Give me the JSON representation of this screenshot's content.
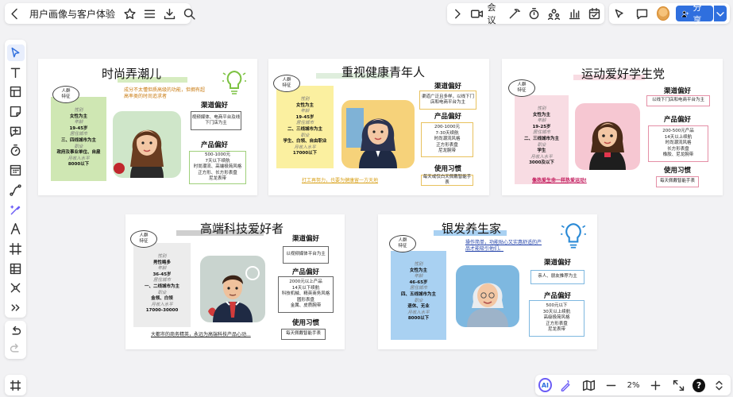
{
  "header": {
    "doc_title": "用户画像与客户体验",
    "meeting_label": "会议",
    "share_label": "分享"
  },
  "bottom": {
    "zoom": "2%",
    "ai_label": "AI"
  },
  "colors": {
    "accent": "#2f6fde",
    "green": "#cfe7b3",
    "yellow": "#fbf0a0",
    "pink": "#f8dce3",
    "gray": "#ececec",
    "blue": "#a9d1f2"
  },
  "cards": [
    {
      "title": "时尚弄潮儿",
      "tag": "人群\n特征",
      "attrs": [
        [
          "性别",
          "女性为主"
        ],
        [
          "年龄",
          "19-45岁"
        ],
        [
          "居住城市",
          "三、四线城市为主"
        ],
        [
          "职业",
          "政府及事业单位、自雇"
        ],
        [
          "月收入水平",
          "8000以下"
        ]
      ],
      "slogan": "成分不太懂但质高级的功能，但拥有超高率类的时尚追求者",
      "channel_title": "渠道偏好",
      "channel": "视频媒体、电商平台及线下门店为主",
      "product_title": "产品偏好",
      "product": "500-1000元\n7天以下续航\n时尚潮流、高端极简风格\n正方形、长方形表盘\n尼龙表带"
    },
    {
      "title": "重视健康青年人",
      "tag": "人群\n特征",
      "attrs": [
        [
          "性别",
          "女性为主"
        ],
        [
          "年龄",
          "19-45岁"
        ],
        [
          "居住城市",
          "二、三线城市为主"
        ],
        [
          "职业",
          "学生、白领、自由职业"
        ],
        [
          "月收入水平",
          "17000以下"
        ]
      ],
      "slogan": "打工再努力，也要为健康留一方天地",
      "channel_title": "渠道偏好",
      "channel": "渠道广泛且多样，以线下门店和电商平台为主",
      "product_title": "产品偏好",
      "product": "200-1000元\n7-30天续航\n时尚潮流风格\n正方形表盘\n尼龙腕带",
      "habit_title": "使用习惯",
      "habit": "每天或仅白天佩戴智能手表"
    },
    {
      "title": "运动爱好学生党",
      "tag": "人群\n特征",
      "attrs": [
        [
          "性别",
          "女性为主"
        ],
        [
          "年龄",
          "19-25岁"
        ],
        [
          "居住城市",
          "二、三线城市为主"
        ],
        [
          "职业",
          "学生"
        ],
        [
          "月收入水平",
          "3000及以下"
        ]
      ],
      "slogan": "像热爱生命一样热爱运动!",
      "channel_title": "渠道偏好",
      "channel": "以线下门店和电商平台为主",
      "product_title": "产品偏好",
      "product": "200-500元产品\n14天以上续航\n时尚潮流风格\n长方形表盘\n橡胶、尼龙腕带",
      "habit_title": "使用习惯",
      "habit": "每天佩戴智能手表"
    },
    {
      "title": "高端科技爱好者",
      "tag": "人群\n特征",
      "attrs": [
        [
          "性别",
          "男性略多"
        ],
        [
          "年龄",
          "36-45岁"
        ],
        [
          "居住城市",
          "一、二线城市为主"
        ],
        [
          "职业",
          "金领、白领"
        ],
        [
          "月收入水平",
          "17000-30000"
        ]
      ],
      "slogan": "大都市的商务精英，永远为高端科技产品心动...",
      "channel_title": "渠道偏好",
      "channel": "以视频媒体平台为主",
      "product_title": "产品偏好",
      "product": "2000元以上产品\n14天以下续航\n科技机械、精英商务风格\n圆形表盘\n金属、皮质腕带",
      "habit_title": "使用习惯",
      "habit": "每天佩戴智能手表"
    },
    {
      "title": "银发养生家",
      "tag": "人群\n特征",
      "attrs": [
        [
          "性别",
          "女性为主"
        ],
        [
          "年龄",
          "46-65岁"
        ],
        [
          "居住城市",
          "四、五线城市为主"
        ],
        [
          "职业",
          "退休、无业"
        ],
        [
          "月收入水平",
          "8000以下"
        ]
      ],
      "slogan": "操作简单，功能贴心又实惠舒适的产品才能吸引他们。",
      "channel_title": "渠道偏好",
      "channel": "亲人、朋友推荐为主",
      "product_title": "产品偏好",
      "product": "500元以下\n30天以上续航\n高级极简风格\n正方形表盘\n尼龙表带"
    }
  ]
}
